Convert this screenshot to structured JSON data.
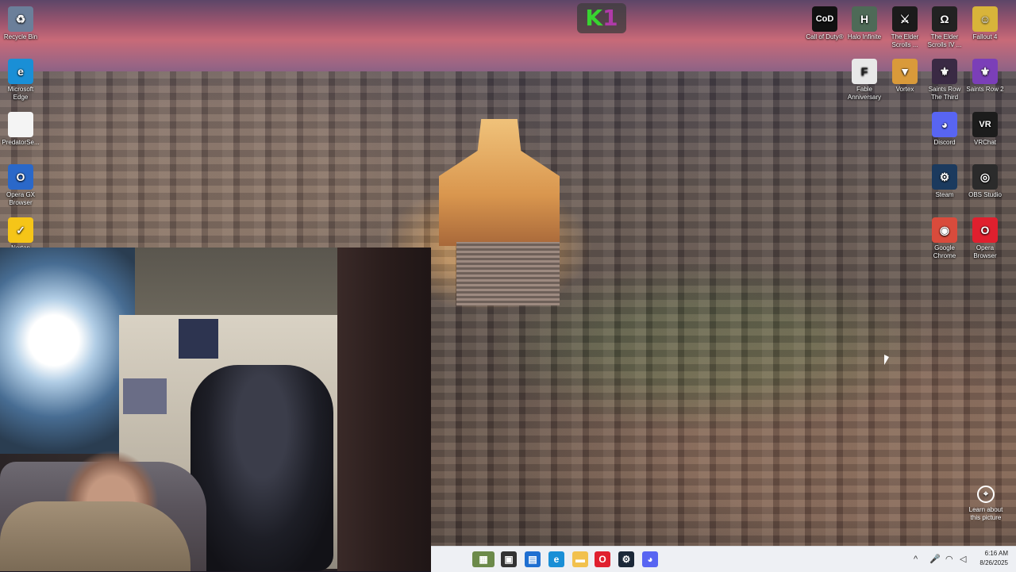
{
  "top_logo": {
    "k": "K",
    "n": "1"
  },
  "left_icons": [
    {
      "label": "Recycle Bin",
      "icon": "recycle-bin-icon",
      "color": "#6b7f9a",
      "glyph": "♻"
    },
    {
      "label": "Microsoft Edge",
      "icon": "edge-icon",
      "color": "#1a8fd6",
      "glyph": "e"
    },
    {
      "label": "PredatorSe...",
      "icon": "document-icon",
      "color": "#f4f4f4",
      "glyph": ""
    },
    {
      "label": "Opera GX Browser",
      "icon": "opera-gx-icon",
      "color": "#2a68c9",
      "glyph": "O"
    },
    {
      "label": "Norton",
      "icon": "norton-icon",
      "color": "#f5c518",
      "glyph": "✓"
    }
  ],
  "right_icons": [
    {
      "label": "Call of Duty®",
      "icon": "call-of-duty-icon",
      "color": "#111111",
      "glyph": "CoD"
    },
    {
      "label": "Halo Infinite",
      "icon": "halo-infinite-icon",
      "color": "#4e6a57",
      "glyph": "H"
    },
    {
      "label": "The Elder Scrolls ...",
      "icon": "elder-scrolls-icon",
      "color": "#1b1b1b",
      "glyph": "⚔"
    },
    {
      "label": "The Elder Scrolls IV ...",
      "icon": "elder-scrolls-iv-icon",
      "color": "#222222",
      "glyph": "Ω"
    },
    {
      "label": "Fallout 4",
      "icon": "fallout-4-icon",
      "color": "#d8b43a",
      "glyph": "☺"
    },
    {
      "label": "Fable Anniversary",
      "icon": "fable-anniversary-icon",
      "color": "#e8e8e8",
      "glyph": "F"
    },
    {
      "label": "Vortex",
      "icon": "vortex-icon",
      "color": "#d99a3a",
      "glyph": "▼"
    },
    {
      "label": "Saints Row The Third",
      "icon": "saints-row-third-icon",
      "color": "#3a2a44",
      "glyph": "⚜"
    },
    {
      "label": "Saints Row 2",
      "icon": "saints-row-2-icon",
      "color": "#7b3fb8",
      "glyph": "⚜"
    },
    {
      "label": "Discord",
      "icon": "discord-icon",
      "color": "#5865f2",
      "glyph": "◕"
    },
    {
      "label": "VRChat",
      "icon": "vrchat-icon",
      "color": "#1c1c1c",
      "glyph": "VR"
    },
    {
      "label": "Steam",
      "icon": "steam-icon",
      "color": "#1b3a5e",
      "glyph": "⚙"
    },
    {
      "label": "OBS Studio",
      "icon": "obs-studio-icon",
      "color": "#2b2b2b",
      "glyph": "◎"
    },
    {
      "label": "Google Chrome",
      "icon": "chrome-icon",
      "color": "#d94b3c",
      "glyph": "◉"
    },
    {
      "label": "Opera Browser",
      "icon": "opera-browser-icon",
      "color": "#e0202e",
      "glyph": "O"
    }
  ],
  "learn": {
    "label": "Learn about this picture",
    "icon": "camera-icon"
  },
  "taskbar": {
    "apps": [
      {
        "icon": "widgets-icon",
        "color": "#6c8a4a",
        "glyph": "▦"
      },
      {
        "icon": "task-view-icon",
        "color": "#333333",
        "glyph": "▣"
      },
      {
        "icon": "store-icon",
        "color": "#1f6fd1",
        "glyph": "▤"
      },
      {
        "icon": "edge-icon",
        "color": "#1a8fd6",
        "glyph": "e"
      },
      {
        "icon": "file-explorer-icon",
        "color": "#f2c14e",
        "glyph": "▬"
      },
      {
        "icon": "opera-icon",
        "color": "#e0202e",
        "glyph": "O"
      },
      {
        "icon": "steam-icon",
        "color": "#1b2838",
        "glyph": "⚙"
      },
      {
        "icon": "discord-icon",
        "color": "#5865f2",
        "glyph": "◕"
      }
    ],
    "tray": {
      "chevron": "^",
      "time": "6:16 AM",
      "date": "8/26/2025"
    }
  }
}
